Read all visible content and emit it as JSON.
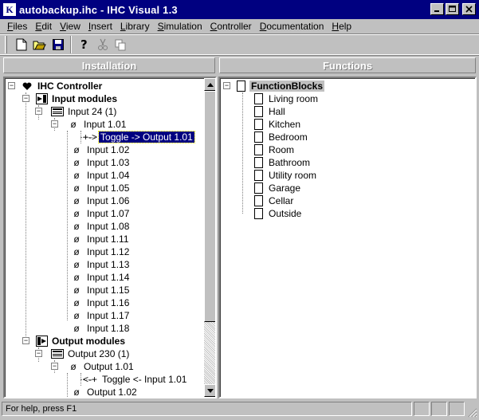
{
  "window": {
    "title": "autobackup.ihc - IHC Visual 1.3",
    "app_icon": "k-logo-icon"
  },
  "menu": [
    {
      "pre": "",
      "ul": "F",
      "post": "iles"
    },
    {
      "pre": "",
      "ul": "E",
      "post": "dit"
    },
    {
      "pre": "",
      "ul": "V",
      "post": "iew"
    },
    {
      "pre": "",
      "ul": "I",
      "post": "nsert"
    },
    {
      "pre": "",
      "ul": "L",
      "post": "ibrary"
    },
    {
      "pre": "",
      "ul": "S",
      "post": "imulation"
    },
    {
      "pre": "",
      "ul": "C",
      "post": "ontroller"
    },
    {
      "pre": "",
      "ul": "D",
      "post": "ocumentation"
    },
    {
      "pre": "",
      "ul": "H",
      "post": "elp"
    }
  ],
  "panels": {
    "left_title": "Installation",
    "right_title": "Functions"
  },
  "installation_tree": [
    {
      "label": "IHC Controller",
      "bold": true
    },
    {
      "label": "Input modules",
      "bold": true
    },
    {
      "label": "Input 24 (1)"
    },
    {
      "label": "Input 1.01"
    },
    {
      "prefix": "+->",
      "label": "Toggle -> Output 1.01",
      "selected": true
    },
    {
      "label": "Input 1.02"
    },
    {
      "label": "Input 1.03"
    },
    {
      "label": "Input 1.04"
    },
    {
      "label": "Input 1.05"
    },
    {
      "label": "Input 1.06"
    },
    {
      "label": "Input 1.07"
    },
    {
      "label": "Input 1.08"
    },
    {
      "label": "Input 1.11"
    },
    {
      "label": "Input 1.12"
    },
    {
      "label": "Input 1.13"
    },
    {
      "label": "Input 1.14"
    },
    {
      "label": "Input 1.15"
    },
    {
      "label": "Input 1.16"
    },
    {
      "label": "Input 1.17"
    },
    {
      "label": "Input 1.18"
    },
    {
      "label": "Output modules",
      "bold": true
    },
    {
      "label": "Output 230 (1)"
    },
    {
      "label": "Output 1.01"
    },
    {
      "prefix": "<-+",
      "label": "Toggle <- Input 1.01"
    },
    {
      "label": "Output 1.02"
    }
  ],
  "functions_tree": {
    "root": "FunctionBlocks",
    "items": [
      "Living room",
      "Hall",
      "Kitchen",
      "Bedroom",
      "Room",
      "Bathroom",
      "Utility room",
      "Garage",
      "Cellar",
      "Outside"
    ]
  },
  "status": {
    "text": "For help, press F1"
  }
}
